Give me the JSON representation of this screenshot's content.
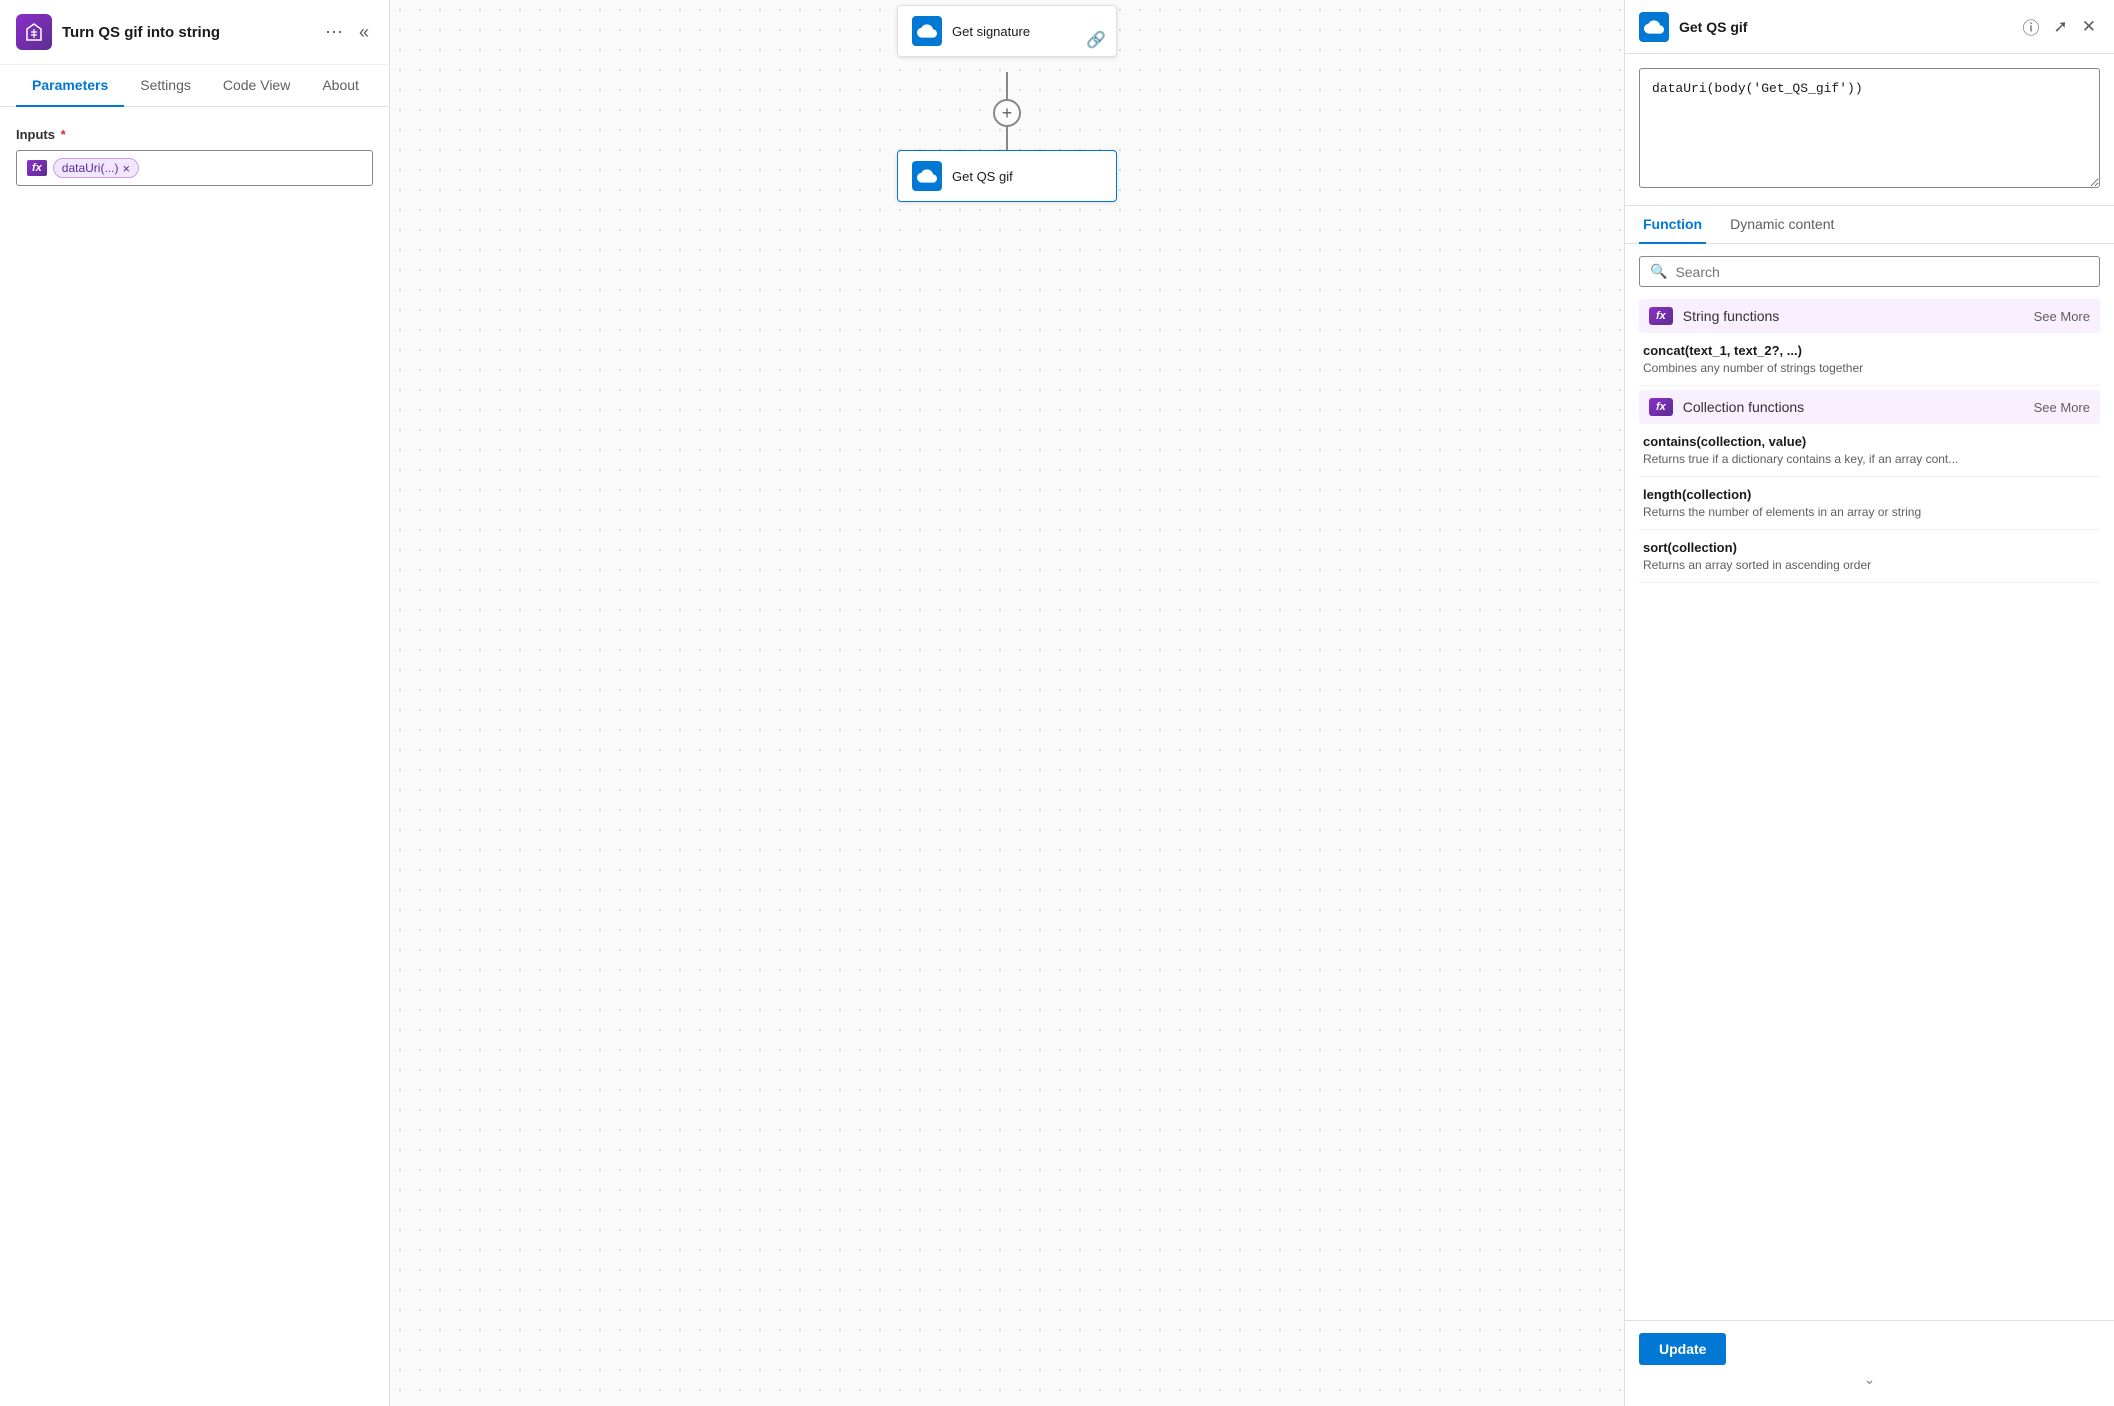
{
  "app": {
    "icon_label": "{/}",
    "title": "Turn QS gif into string"
  },
  "header": {
    "more_options_icon": "⋯",
    "collapse_icon": "«"
  },
  "tabs": [
    {
      "id": "parameters",
      "label": "Parameters",
      "active": true
    },
    {
      "id": "settings",
      "label": "Settings",
      "active": false
    },
    {
      "id": "codeview",
      "label": "Code View",
      "active": false
    },
    {
      "id": "about",
      "label": "About",
      "active": false
    }
  ],
  "inputs_field": {
    "label": "Inputs",
    "required": true,
    "token_label": "dataUri(...)",
    "fx_badge": "fx"
  },
  "workflow": {
    "node1": {
      "title": "Get signature",
      "icon_color": "#0078d4"
    },
    "node2": {
      "title": "Get QS gif",
      "icon_color": "#0078d4"
    }
  },
  "right_panel": {
    "node_title": "Get QS gif",
    "info_icon": "ⓘ",
    "expand_icon": "⤢",
    "close_icon": "✕",
    "formula": "dataUri(body('Get_QS_gif'))",
    "tabs": [
      {
        "id": "function",
        "label": "Function",
        "active": true
      },
      {
        "id": "dynamic",
        "label": "Dynamic content",
        "active": false
      }
    ],
    "search": {
      "placeholder": "Search",
      "icon": "🔍"
    },
    "categories": [
      {
        "id": "string-functions",
        "name": "String functions",
        "see_more": "See More",
        "items": [
          {
            "signature": "concat(text_1, text_2?, ...)",
            "description": "Combines any number of strings together"
          }
        ]
      },
      {
        "id": "collection-functions",
        "name": "Collection functions",
        "see_more": "See More",
        "items": [
          {
            "signature": "contains(collection, value)",
            "description": "Returns true if a dictionary contains a key, if an array cont..."
          },
          {
            "signature": "length(collection)",
            "description": "Returns the number of elements in an array or string"
          },
          {
            "signature": "sort(collection)",
            "description": "Returns an array sorted in ascending order"
          }
        ]
      }
    ],
    "update_button": "Update"
  }
}
